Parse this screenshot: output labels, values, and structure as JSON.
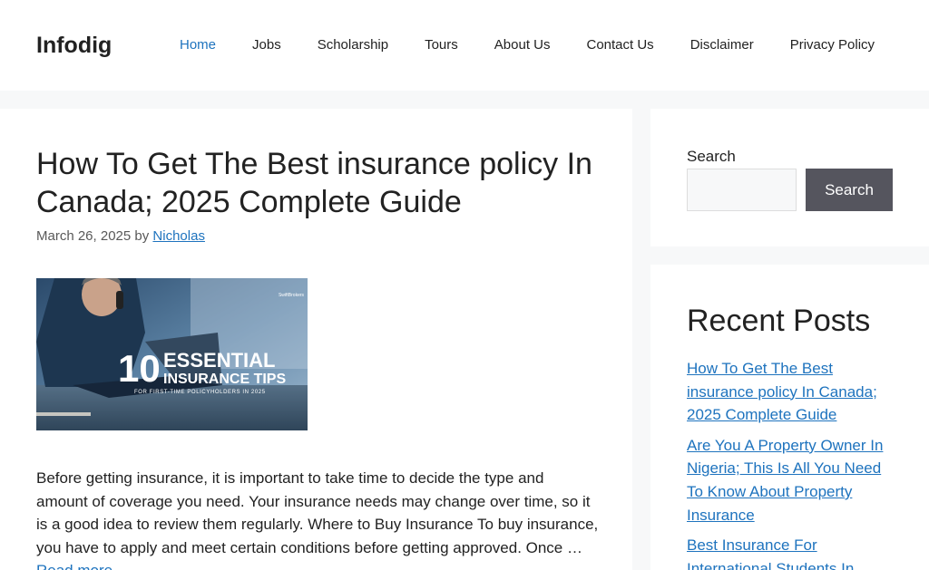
{
  "site": {
    "title": "Infodig"
  },
  "nav": {
    "items": [
      {
        "label": "Home",
        "active": true
      },
      {
        "label": "Jobs"
      },
      {
        "label": "Scholarship"
      },
      {
        "label": "Tours"
      },
      {
        "label": "About Us"
      },
      {
        "label": "Contact Us"
      },
      {
        "label": "Disclaimer"
      },
      {
        "label": "Privacy Policy"
      }
    ]
  },
  "post": {
    "title": "How To Get The Best insurance policy In Canada; 2025 Complete Guide",
    "date": "March 26, 2025",
    "by": "by",
    "author": "Nicholas",
    "image": {
      "big_number": "10",
      "line1": "ESSENTIAL",
      "line2": "INSURANCE TIPS",
      "line3": "FOR FIRST-TIME POLICYHOLDERS IN 2025",
      "brand": "SwiftBrokers"
    },
    "excerpt": "Before getting insurance, it is important to take time to decide the type and amount of coverage you need. Your insurance needs may change over time, so it is a good idea to review them regularly. Where to Buy Insurance To buy insurance, you have to apply and meet certain conditions before getting approved. Once …",
    "read_more": "Read more"
  },
  "sidebar": {
    "search_label": "Search",
    "search_button": "Search",
    "search_value": "",
    "recent_title": "Recent Posts",
    "recent_posts": [
      "How To Get The Best insurance policy In Canada; 2025 Complete Guide",
      "Are You A Property Owner In Nigeria; This Is All You Need To Know About Property Insurance",
      "Best Insurance For International Students In"
    ]
  },
  "colors": {
    "link": "#1e73be",
    "button": "#55555e",
    "background": "#f7f8f9"
  }
}
